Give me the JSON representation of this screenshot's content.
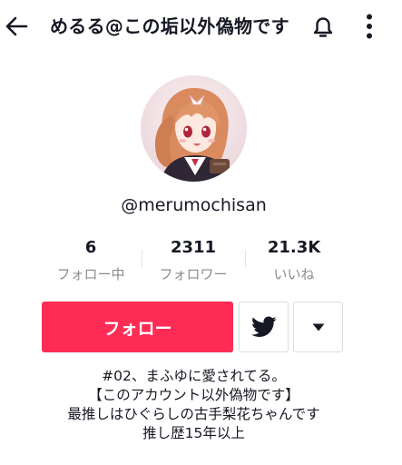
{
  "header": {
    "title": "めるる@この垢以外偽物です",
    "icons": {
      "back": "arrow-left-icon",
      "notifications": "bell-icon",
      "more": "more-vertical-icon"
    }
  },
  "profile": {
    "avatar": "anime-girl-avatar",
    "handle": "@merumochisan"
  },
  "stats": [
    {
      "value": "6",
      "label": "フォロー中"
    },
    {
      "value": "2311",
      "label": "フォロワー"
    },
    {
      "value": "21.3K",
      "label": "いいね"
    }
  ],
  "actions": {
    "follow_label": "フォロー",
    "twitter_icon": "twitter-bird-icon",
    "dropdown_icon": "caret-down-icon"
  },
  "bio": [
    "#02、まふゆに愛されてる。",
    "【このアカウント以外偽物です】",
    "最推しはひぐらしの古手梨花ちゃんです",
    "推し歴15年以上"
  ],
  "colors": {
    "accent": "#fe2c55",
    "text": "#161823",
    "muted": "#8a8b91",
    "border": "#dcdcdf"
  }
}
